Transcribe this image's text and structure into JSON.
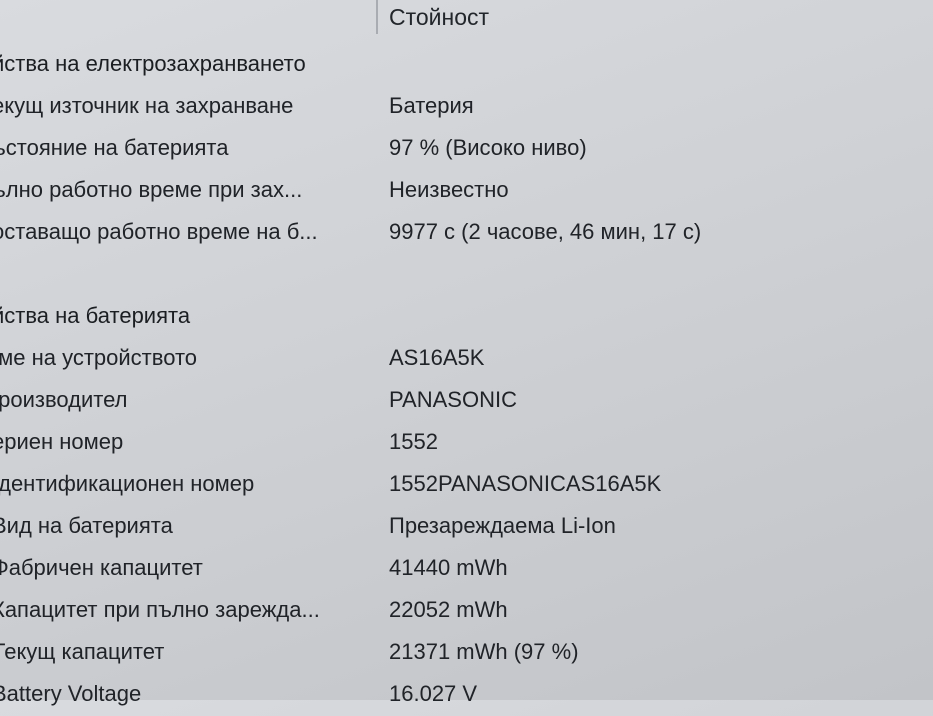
{
  "header": {
    "value_column_label": "Стойност"
  },
  "power_section": {
    "title": "йства на електрозахранването",
    "rows": [
      {
        "label": "екущ източник на захранване",
        "value": "Батерия"
      },
      {
        "label": "ъстояние на батерията",
        "value": "97 % (Високо ниво)"
      },
      {
        "label": "ълно работно време при зах...",
        "value": "Неизвестно"
      },
      {
        "label": "оставащо работно време на б...",
        "value": "9977 с (2 часове, 46 мин, 17 с)"
      }
    ]
  },
  "battery_section": {
    "title": "йства на батерията",
    "rows": [
      {
        "label": "Іме на устройството",
        "value": "AS16A5K"
      },
      {
        "label": "Іроизводител",
        "value": "PANASONIC"
      },
      {
        "label": "ериен номер",
        "value": "1552"
      },
      {
        "label": "Ідентификационен номер",
        "value": "1552PANASONICAS16A5K"
      },
      {
        "label": "Вид на батерията",
        "value": "Презареждаема Li-Ion"
      },
      {
        "label": "Фабричен капацитет",
        "value": "41440 mWh"
      },
      {
        "label": "Капацитет при пълно зарежда...",
        "value": "22052 mWh"
      },
      {
        "label": "Текущ капацитет",
        "value": "21371 mWh  (97 %)"
      },
      {
        "label": "Battery Voltage",
        "value": "16.027 V"
      }
    ]
  }
}
